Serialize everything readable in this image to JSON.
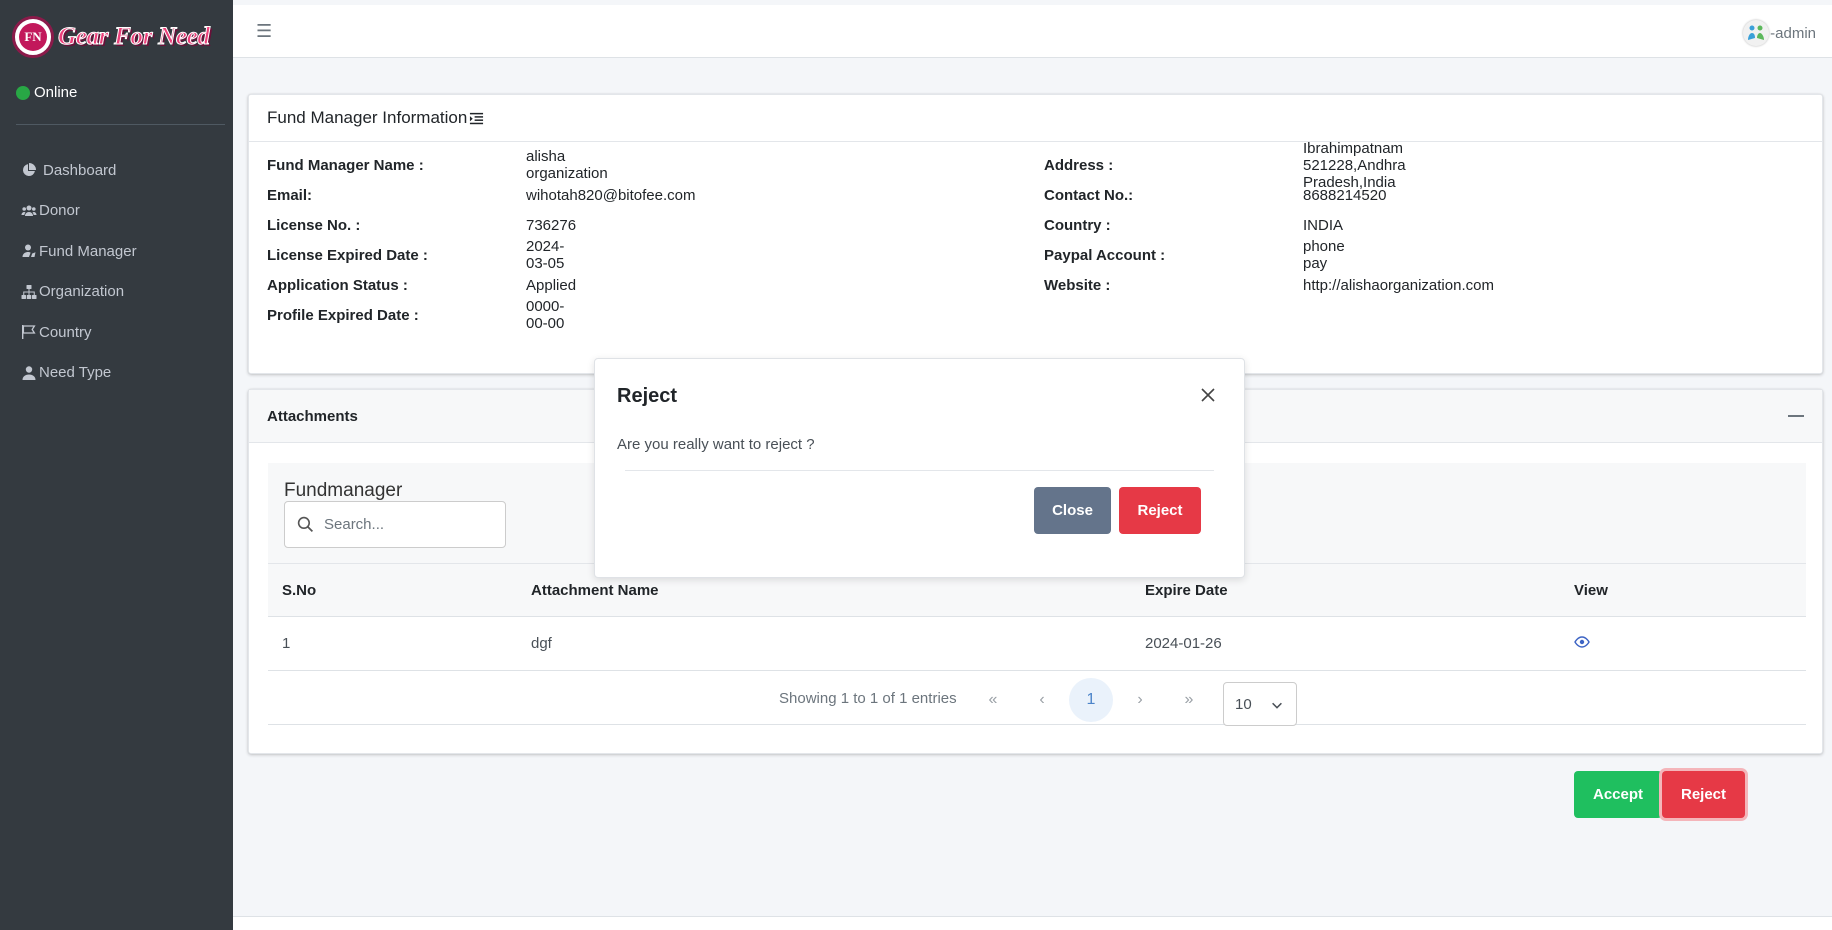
{
  "brand": {
    "logo_mark": "FN",
    "name": "Gear For Need"
  },
  "status": {
    "online_label": "Online"
  },
  "sidebar": {
    "items": [
      {
        "label": "Dashboard",
        "icon": "pie-chart-icon"
      },
      {
        "label": "Donor",
        "icon": "users-icon"
      },
      {
        "label": "Fund Manager",
        "icon": "user-icon"
      },
      {
        "label": "Organization",
        "icon": "sitemap-icon"
      },
      {
        "label": "Country",
        "icon": "flag-icon"
      },
      {
        "label": "Need Type",
        "icon": "user-check-icon"
      }
    ]
  },
  "topbar": {
    "menu_icon": "hamburger-icon",
    "user_label": "-admin"
  },
  "info": {
    "title": "Fund Manager Information",
    "left": [
      {
        "label": "Fund Manager Name :",
        "value": "alisha organization"
      },
      {
        "label": "Email:",
        "value": "wihotah820@bitofee.com"
      },
      {
        "label": "License No. :",
        "value": "736276"
      },
      {
        "label": "License Expired Date :",
        "value": "2024-03-05"
      },
      {
        "label": "Application Status :",
        "value": "Applied"
      },
      {
        "label": "Profile Expired Date :",
        "value": "0000-00-00"
      }
    ],
    "right": [
      {
        "label": "Address :",
        "value": "Ibrahimpatnam 521228,Andhra Pradesh,India"
      },
      {
        "label": "Contact No.:",
        "value": "8688214520"
      },
      {
        "label": "Country :",
        "value": "INDIA"
      },
      {
        "label": "Paypal Account :",
        "value": "phone pay"
      },
      {
        "label": "Website :",
        "value": "http://alishaorganization.com"
      }
    ]
  },
  "attachments": {
    "title": "Attachments",
    "panel_title": "Fundmanager",
    "search_placeholder": "Search...",
    "columns": [
      "S.No",
      "Attachment Name",
      "Expire Date",
      "View"
    ],
    "rows": [
      {
        "sno": "1",
        "name": "dgf",
        "expire": "2024-01-26"
      }
    ],
    "pagination": {
      "info": "Showing 1 to 1 of 1 entries",
      "first": "«",
      "prev": "‹",
      "current": "1",
      "next": "›",
      "last": "»",
      "page_size": "10"
    }
  },
  "actions": {
    "accept": "Accept",
    "reject": "Reject"
  },
  "modal": {
    "title": "Reject",
    "body": "Are you really want to reject ?",
    "close_label": "Close",
    "reject_label": "Reject"
  },
  "colors": {
    "sidebar": "#343a40",
    "accept": "#1fbf5f",
    "reject": "#e63946",
    "close": "#64748b",
    "online": "#28a745"
  }
}
